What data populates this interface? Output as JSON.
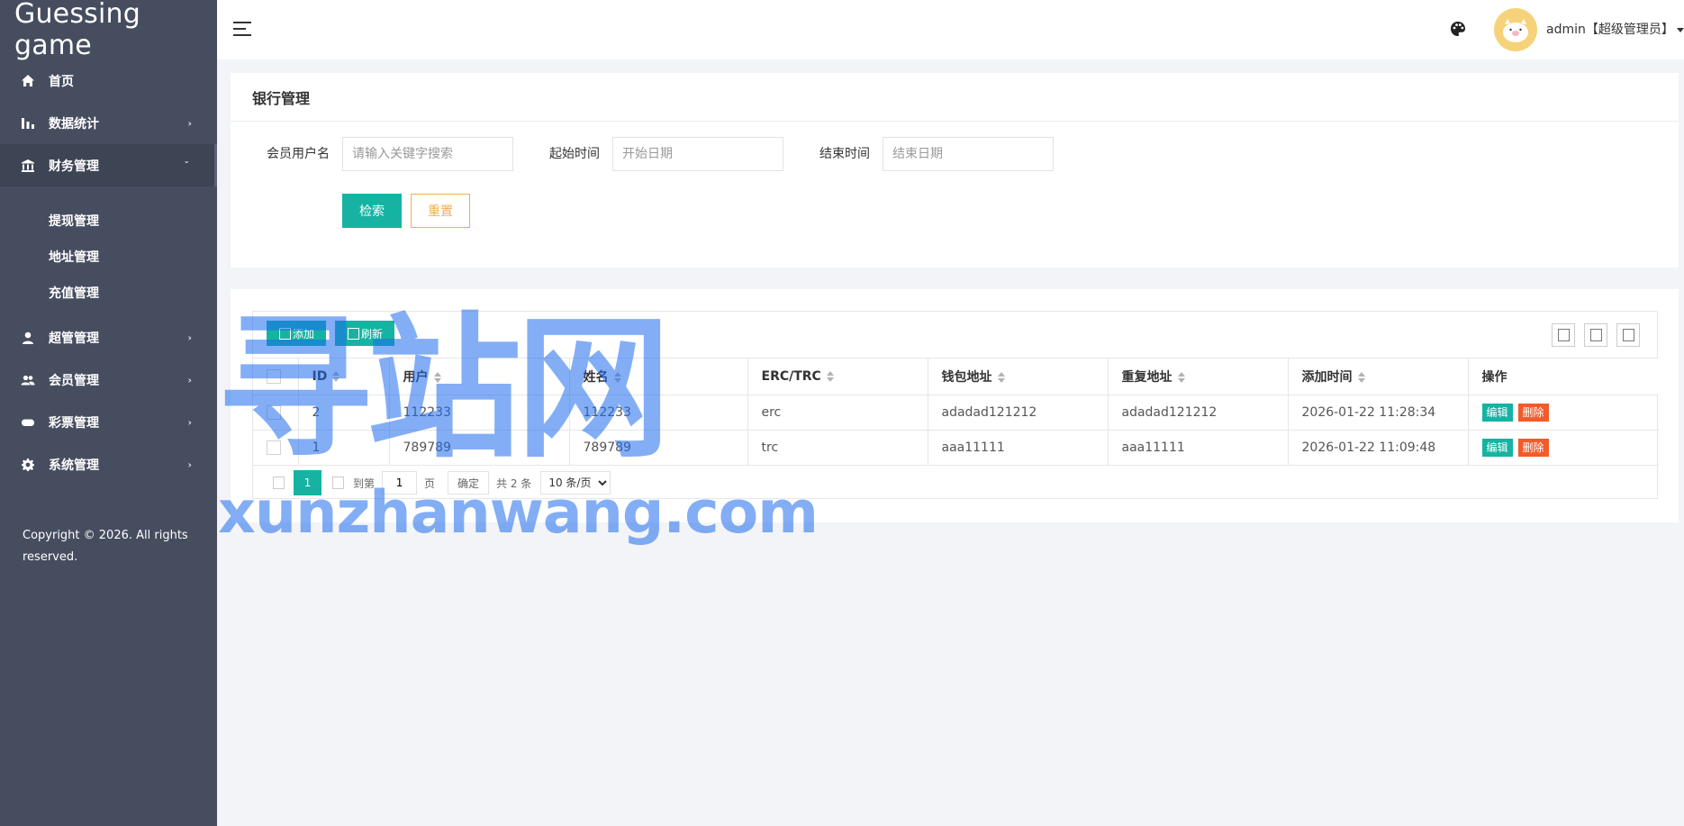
{
  "brand": "Guessing game",
  "sidebar": {
    "items": [
      {
        "label": "首页",
        "icon": "home-icon"
      },
      {
        "label": "数据统计",
        "icon": "bar-chart-icon"
      },
      {
        "label": "财务管理",
        "icon": "bank-icon"
      },
      {
        "label": "超管管理",
        "icon": "user-icon"
      },
      {
        "label": "会员管理",
        "icon": "users-icon"
      },
      {
        "label": "彩票管理",
        "icon": "gamepad-icon"
      },
      {
        "label": "系统管理",
        "icon": "gear-icon"
      }
    ],
    "finance_sub": [
      "提现管理",
      "地址管理",
      "充值管理"
    ],
    "copyright": "Copyright © 2026. All rights reserved."
  },
  "header": {
    "user_label": "admin【超级管理员】"
  },
  "search_panel": {
    "title": "银行管理",
    "username_label": "会员用户名",
    "username_placeholder": "请输入关键字搜索",
    "start_label": "起始时间",
    "start_placeholder": "开始日期",
    "end_label": "结束时间",
    "end_placeholder": "结束日期",
    "search_btn": "检索",
    "reset_btn": "重置"
  },
  "table": {
    "add_btn": "添加",
    "refresh_btn": "刷新",
    "columns": [
      "ID",
      "用户",
      "姓名",
      "ERC/TRC",
      "钱包地址",
      "重复地址",
      "添加时间",
      "操作"
    ],
    "rows": [
      {
        "id": "2",
        "user": "112233",
        "name": "112233",
        "type": "erc",
        "wallet": "adadad121212",
        "dup": "adadad121212",
        "time": "2026-01-22 11:28:34"
      },
      {
        "id": "1",
        "user": "789789",
        "name": "789789",
        "type": "trc",
        "wallet": "aaa11111",
        "dup": "aaa11111",
        "time": "2026-01-22 11:09:48"
      }
    ],
    "edit_label": "编辑",
    "delete_label": "删除"
  },
  "pager": {
    "current": "1",
    "goto_label": "到第",
    "page_input": "1",
    "page_unit": "页",
    "confirm": "确定",
    "total": "共 2 条",
    "per_page": "10 条/页"
  },
  "watermark": {
    "cn": "寻站网",
    "en": "xunzhanwang.com"
  },
  "colors": {
    "sidebar": "#464d5f",
    "accent": "#16b3a2",
    "danger": "#f25b2a",
    "warning": "#f0ad4e"
  }
}
